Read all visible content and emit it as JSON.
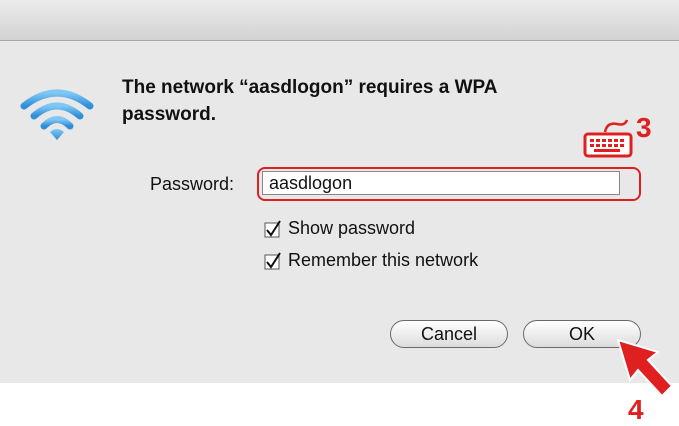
{
  "dialog": {
    "message": "The network “aasdlogon” requires a WPA password.",
    "password_label": "Password:",
    "password_value": "aasdlogon",
    "show_password_label": "Show password",
    "show_password_checked": true,
    "remember_label": "Remember this network",
    "remember_checked": true,
    "cancel_label": "Cancel",
    "ok_label": "OK"
  },
  "annotations": {
    "step_3": "3",
    "step_4": "4",
    "color": "#e02020"
  },
  "icons": {
    "wifi": "wifi-icon",
    "keyboard": "keyboard-icon",
    "pointer": "arrow-pointer-icon"
  }
}
